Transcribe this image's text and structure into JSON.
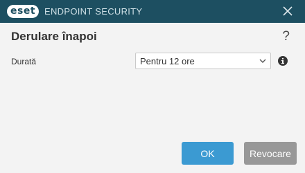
{
  "titlebar": {
    "logo_mark": "eset",
    "product": "ENDPOINT SECURITY",
    "close_icon": "close-icon"
  },
  "dialog": {
    "title": "Derulare înapoi",
    "help": "?"
  },
  "duration": {
    "label": "Durată",
    "selected": "Pentru 12 ore",
    "info_icon": "info-icon"
  },
  "buttons": {
    "ok": "OK",
    "cancel": "Revocare"
  },
  "colors": {
    "titlebar": "#1d4f61",
    "primary": "#3b9ad2",
    "secondary": "#989898",
    "background": "#f3f3f3"
  }
}
